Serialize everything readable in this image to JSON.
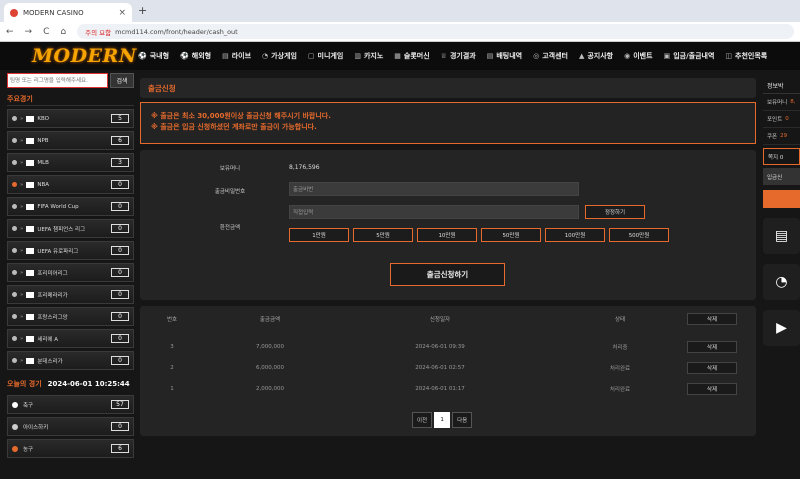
{
  "browser": {
    "tab_title": "MODERN CASINO",
    "tab_close": "×",
    "new_tab": "+",
    "url_warning": "주의 요함",
    "url": "mcmd114.com/front/header/cash_out",
    "nav": [
      "←",
      "→",
      "C",
      "⌂"
    ]
  },
  "site": {
    "logo": "MODERN",
    "menu": [
      {
        "icon": "⚽",
        "label": "국내형"
      },
      {
        "icon": "⚽",
        "label": "해외형"
      },
      {
        "icon": "▤",
        "label": "라이브"
      },
      {
        "icon": "◔",
        "label": "가상게임"
      },
      {
        "icon": "▢",
        "label": "미니게임"
      },
      {
        "icon": "▥",
        "label": "카지노"
      },
      {
        "icon": "▦",
        "label": "슬롯머신"
      },
      {
        "icon": "♕",
        "label": "경기결과"
      },
      {
        "icon": "▤",
        "label": "배팅내역"
      },
      {
        "icon": "◎",
        "label": "고객센터"
      },
      {
        "icon": "▲",
        "label": "공지사항"
      },
      {
        "icon": "◉",
        "label": "이벤트"
      },
      {
        "icon": "▣",
        "label": "입금/출금내역"
      },
      {
        "icon": "◫",
        "label": "추천인목록"
      }
    ]
  },
  "sidebar": {
    "search_placeholder": "팀명 또는 리그명을 입력해주세요.",
    "search_button": "검색",
    "main_leagues_title": "주요경기",
    "leagues": [
      {
        "name": "KBO",
        "count": "5",
        "dot": "#bbb"
      },
      {
        "name": "NPB",
        "count": "6",
        "dot": "#bbb"
      },
      {
        "name": "MLB",
        "count": "3",
        "dot": "#bbb"
      },
      {
        "name": "NBA",
        "count": "0",
        "dot": "#e66a2c"
      },
      {
        "name": "FIFA World Cup",
        "count": "0",
        "dot": "#bbb"
      },
      {
        "name": "UEFA 챔피언스 리그",
        "count": "0",
        "dot": "#bbb"
      },
      {
        "name": "UEFA 유로파리그",
        "count": "0",
        "dot": "#bbb"
      },
      {
        "name": "프리미어리그",
        "count": "0",
        "dot": "#bbb"
      },
      {
        "name": "프리메라리가",
        "count": "0",
        "dot": "#bbb"
      },
      {
        "name": "프랑스리그앙",
        "count": "0",
        "dot": "#bbb"
      },
      {
        "name": "세리에 A",
        "count": "0",
        "dot": "#bbb"
      },
      {
        "name": "분데스리가",
        "count": "0",
        "dot": "#bbb"
      }
    ],
    "today_label": "오늘의 경기",
    "today_datetime": "2024-06-01 10:25:44",
    "sports": [
      {
        "name": "축구",
        "count": "57",
        "color": "#fff"
      },
      {
        "name": "아이스하키",
        "count": "0",
        "color": "#ccc"
      },
      {
        "name": "농구",
        "count": "6",
        "color": "#e66a2c"
      }
    ]
  },
  "main": {
    "title": "출금신청",
    "notice_lines": [
      "※ 출금은 최소 30,000원이상 출금신청 해주시기 바랍니다.",
      "※ 출금은 입금 신청하셨던 계좌로만 출금이 가능합니다."
    ],
    "form": {
      "balance_label": "보유머니",
      "balance_value": "8,176,596",
      "password_label": "출금비밀번호",
      "password_placeholder": "출금비번",
      "amount_label": "환전금액",
      "amount_placeholder": "직접입력",
      "reset_button": "정정하기",
      "amount_buttons": [
        "1만원",
        "5만원",
        "10만원",
        "50만원",
        "100만원",
        "500만원"
      ],
      "submit_button": "출금신청하기"
    },
    "table": {
      "headers": [
        "번호",
        "출금금액",
        "신청일자",
        "상태",
        "삭제"
      ],
      "rows": [
        {
          "no": "3",
          "amount": "7,000,000",
          "date": "2024-06-01 09:39",
          "status": "처리중",
          "action": "삭제"
        },
        {
          "no": "2",
          "amount": "6,000,000",
          "date": "2024-06-01 02:57",
          "status": "처리완료",
          "action": "삭제"
        },
        {
          "no": "1",
          "amount": "2,000,000",
          "date": "2024-06-01 01:17",
          "status": "처리완료",
          "action": "삭제"
        }
      ],
      "pager": {
        "prev": "이전",
        "current": "1",
        "next": "다음"
      }
    }
  },
  "right": {
    "title": "정보박",
    "rows": [
      {
        "label": "보유머니",
        "value": "8,"
      },
      {
        "label": "포인트",
        "value": "0"
      },
      {
        "label": "쿠폰",
        "value": "29"
      }
    ],
    "box1": "쪽지 0",
    "box2": "입금신",
    "icons": [
      "monitor-icon",
      "speedometer-icon",
      "video-icon"
    ]
  },
  "colors": {
    "accent": "#e66a2c",
    "logo": "#f5a400",
    "background": "#161616"
  }
}
